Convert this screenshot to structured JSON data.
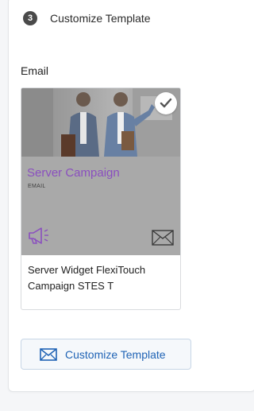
{
  "step": {
    "number": "3",
    "title": "Customize Template"
  },
  "section": {
    "label": "Email"
  },
  "template_card": {
    "preview_title": "Server Campaign",
    "preview_subtitle": "EMAIL",
    "name": "Server Widget FlexiTouch Campaign STES T",
    "selected": true
  },
  "customize_button": {
    "label": "Customize Template"
  },
  "icons": {
    "step_badge": "step-number-badge",
    "selected": "checkmark-icon",
    "campaign_type": "megaphone-icon",
    "channel": "envelope-icon",
    "button": "envelope-icon"
  },
  "colors": {
    "accent_purple": "#8a4fbf",
    "button_text": "#1f63b5",
    "preview_overlay": "#a9a9a9"
  }
}
